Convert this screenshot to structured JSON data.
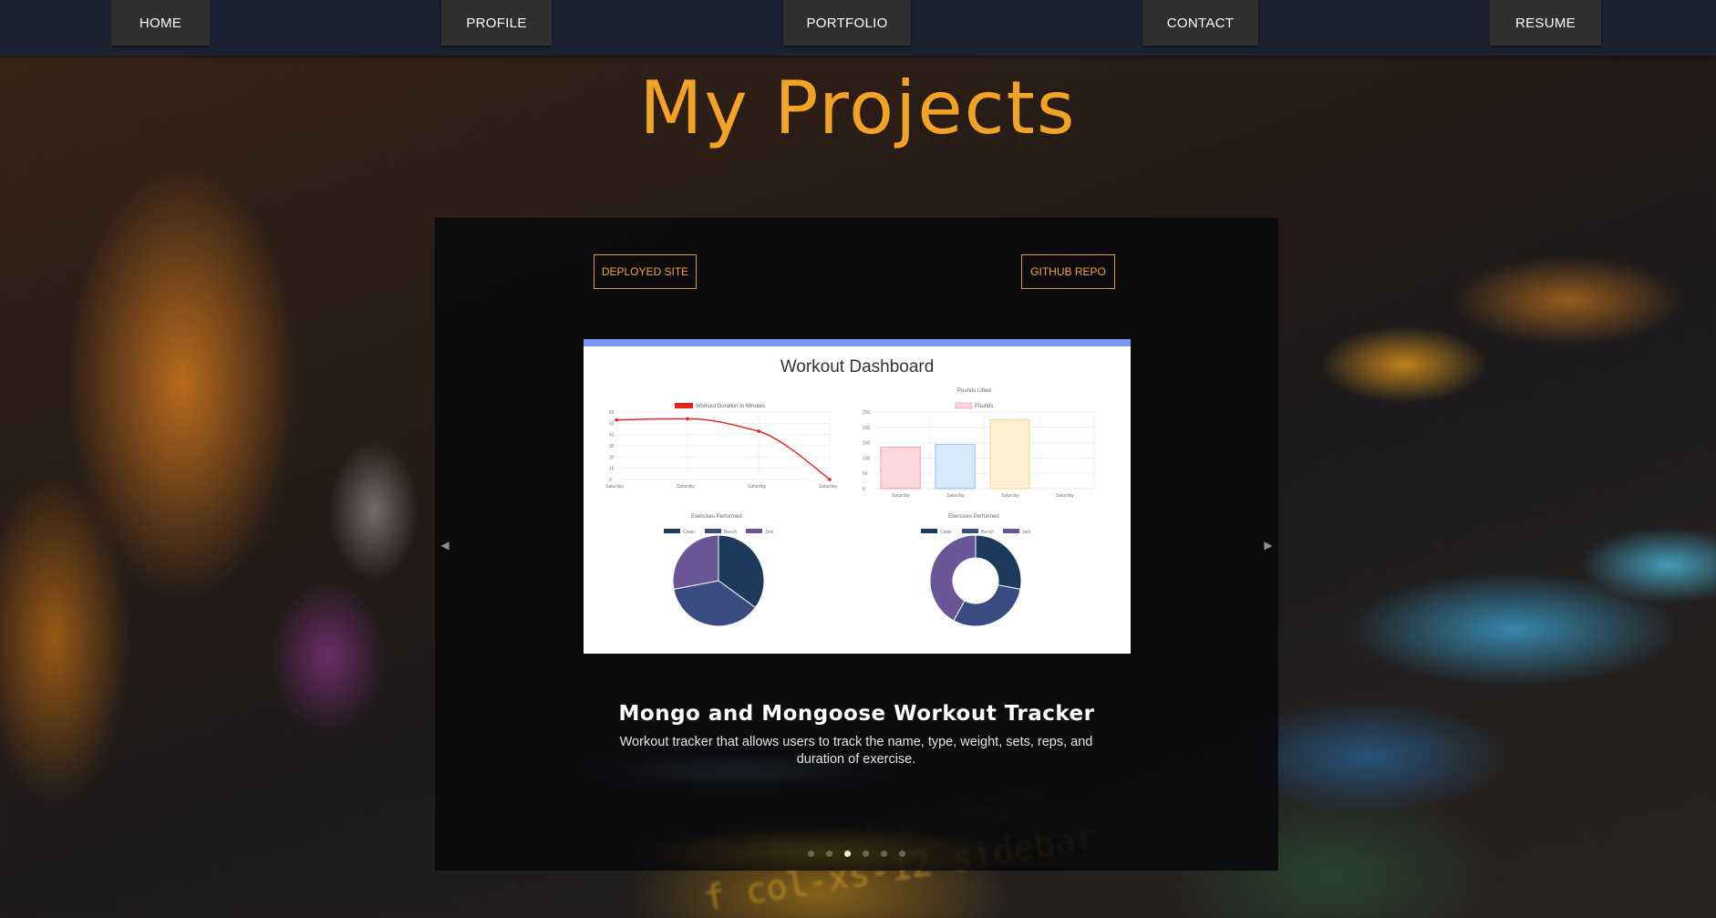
{
  "nav": {
    "items": [
      {
        "label": "HOME"
      },
      {
        "label": "PROFILE"
      },
      {
        "label": "PORTFOLIO"
      },
      {
        "label": "CONTACT"
      },
      {
        "label": "RESUME"
      }
    ]
  },
  "page": {
    "title": "My Projects"
  },
  "carousel": {
    "deployed_label": "DEPLOYED SITE",
    "github_label": "GITHUB REPO",
    "prev_icon": "chevron-left-icon",
    "next_icon": "chevron-right-icon",
    "slide": {
      "title": "Mongo and Mongoose Workout Tracker",
      "description": "Workout tracker that allows users to track the name, type, weight, sets, reps, and duration of exercise.",
      "screenshot": {
        "heading": "Workout Dashboard",
        "line_chart": {
          "legend": "Workout Duration In Minutes",
          "y_ticks": [
            "60",
            "50",
            "40",
            "30",
            "20",
            "10",
            "0"
          ],
          "x_ticks": [
            "Saturday",
            "Saturday",
            "Saturday",
            "Saturday"
          ],
          "values": [
            53,
            54,
            43,
            0
          ]
        },
        "bar_chart": {
          "title": "Pounds Lifted",
          "legend": "Pounds",
          "y_ticks": [
            "250",
            "200",
            "150",
            "100",
            "50",
            "0"
          ],
          "x_ticks": [
            "Saturday",
            "Saturday",
            "Saturday",
            "Saturday"
          ],
          "values": [
            135,
            145,
            225,
            0
          ]
        },
        "pie_chart": {
          "title": "Exercises Performed",
          "legend": [
            "Clean",
            "Bench",
            "Jerk"
          ],
          "values": [
            35,
            37,
            28
          ]
        },
        "donut_chart": {
          "title": "Exercises Performed",
          "legend": [
            "Clean",
            "Bench",
            "Jerk"
          ],
          "values": [
            28,
            30,
            42
          ]
        }
      }
    },
    "indicator_count": 6,
    "active_index": 2
  },
  "colors": {
    "accent": "#f2a225",
    "navbar": "#1b2130",
    "nav_button": "#2f2f30",
    "screenshot_topbar": "#7b98f4",
    "pie_clean": "#1b3a5c",
    "pie_bench": "#3a4b82",
    "pie_jerk": "#6a5597"
  }
}
